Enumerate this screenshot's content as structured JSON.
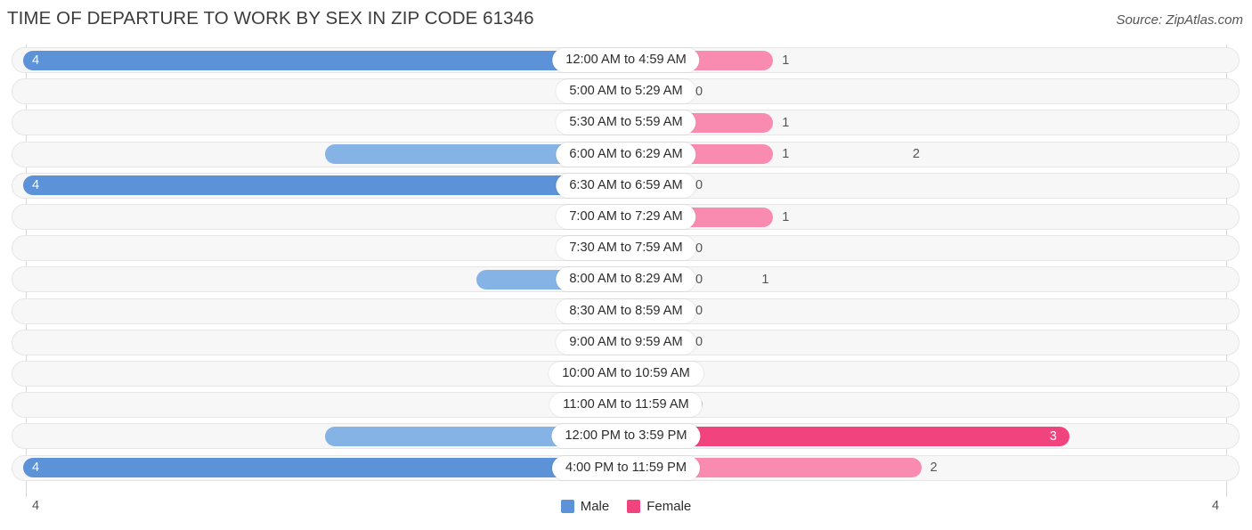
{
  "header": {
    "title": "TIME OF DEPARTURE TO WORK BY SEX IN ZIP CODE 61346",
    "source": "Source: ZipAtlas.com"
  },
  "legend": {
    "male_label": "Male",
    "female_label": "Female",
    "male_color": "#5b92d8",
    "female_color": "#f1437e"
  },
  "axis": {
    "left_max": "4",
    "right_max": "4"
  },
  "chart_data": {
    "type": "bar",
    "title": "TIME OF DEPARTURE TO WORK BY SEX IN ZIP CODE 61346",
    "subtitle": "Source: ZipAtlas.com",
    "orientation": "horizontal-diverging",
    "xlabel": "",
    "ylabel": "",
    "xlim": [
      4,
      4
    ],
    "grid": false,
    "legend_position": "bottom-center",
    "categories": [
      "12:00 AM to 4:59 AM",
      "5:00 AM to 5:29 AM",
      "5:30 AM to 5:59 AM",
      "6:00 AM to 6:29 AM",
      "6:30 AM to 6:59 AM",
      "7:00 AM to 7:29 AM",
      "7:30 AM to 7:59 AM",
      "8:00 AM to 8:29 AM",
      "8:30 AM to 8:59 AM",
      "9:00 AM to 9:59 AM",
      "10:00 AM to 10:59 AM",
      "11:00 AM to 11:59 AM",
      "12:00 PM to 3:59 PM",
      "4:00 PM to 11:59 PM"
    ],
    "series": [
      {
        "name": "Male",
        "values": [
          4,
          0,
          0,
          2,
          4,
          0,
          0,
          1,
          0,
          0,
          0,
          0,
          2,
          4
        ]
      },
      {
        "name": "Female",
        "values": [
          1,
          0,
          1,
          1,
          0,
          1,
          0,
          0,
          0,
          0,
          0,
          0,
          3,
          2
        ]
      }
    ]
  }
}
